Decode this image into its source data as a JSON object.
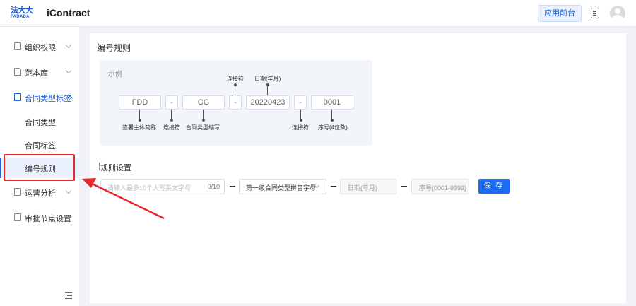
{
  "header": {
    "logo_cn": "法大大",
    "logo_en": "FADADA",
    "app_name": "iContract",
    "front_button": "应用前台"
  },
  "sidebar": {
    "items": [
      {
        "label": "组织权限",
        "icon": "document-icon"
      },
      {
        "label": "范本库",
        "icon": "folder-icon"
      },
      {
        "label": "合同类型标签",
        "icon": "clipboard-icon",
        "expanded": true
      },
      {
        "label": "运营分析",
        "icon": "chart-icon"
      },
      {
        "label": "审批节点设置",
        "icon": "folder-settings-icon"
      }
    ],
    "subitems": [
      {
        "label": "合同类型"
      },
      {
        "label": "合同标签"
      },
      {
        "label": "编号规则",
        "selected": true
      }
    ]
  },
  "main": {
    "title": "编号规则",
    "example": {
      "label": "示例",
      "segments": [
        "FDD",
        "-",
        "CG",
        "-",
        "20220423",
        "-",
        "0001"
      ],
      "captions_below": [
        "签署主体简称",
        "连接符",
        "合同类型缩写",
        "连接符",
        "序号(4位数)"
      ],
      "captions_above": [
        "连接符",
        "日期(年月)"
      ]
    },
    "rule": {
      "title": "规则设置",
      "input_placeholder": "请输入最多10个大写英文字母",
      "input_count": "0/10",
      "select_value": "第一级合同类型拼音字母",
      "date_field": "日期(年月)",
      "seq_field": "序号(0001-9999)",
      "save_button": "保 存"
    }
  },
  "colors": {
    "accent": "#1a6cf0",
    "annotation_red": "#e8262b"
  }
}
